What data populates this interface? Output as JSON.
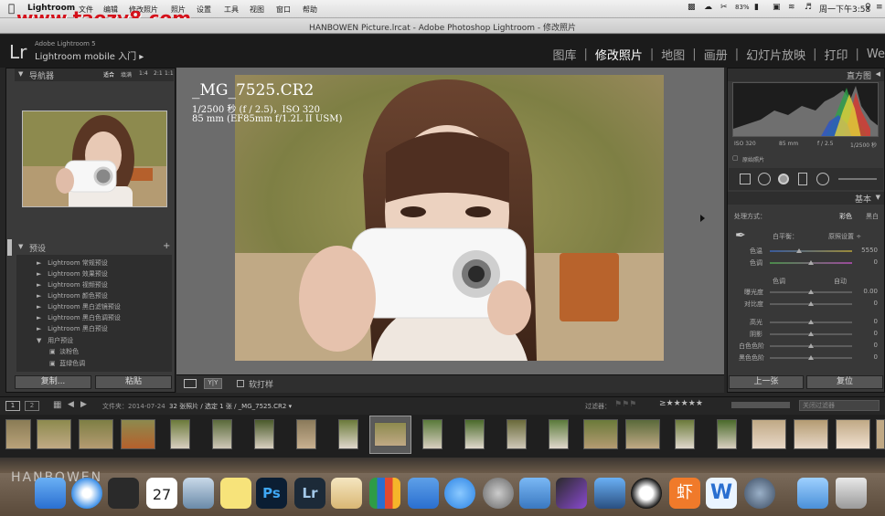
{
  "menubar": {
    "app": "Lightroom",
    "menus": [
      "文件",
      "编辑",
      "修改照片",
      "照片",
      "设置",
      "工具",
      "视图",
      "窗口",
      "帮助"
    ],
    "status_time": "周一下午3:58",
    "battery": "83%",
    "watermark": "www.taozy8.com"
  },
  "window": {
    "title": "HANBOWEN Picture.lrcat - Adobe Photoshop Lightroom - 修改照片"
  },
  "identity": {
    "logo": "Lr",
    "line1": "Adobe Lightroom 5",
    "line2": "Lightroom mobile 入门 ▸"
  },
  "modules": [
    {
      "label": "图库",
      "active": false
    },
    {
      "label": "修改照片",
      "active": true
    },
    {
      "label": "地图",
      "active": false
    },
    {
      "label": "画册",
      "active": false
    },
    {
      "label": "幻灯片放映",
      "active": false
    },
    {
      "label": "打印",
      "active": false
    },
    {
      "label": "We",
      "active": false
    }
  ],
  "navigator": {
    "title": "导航器",
    "zoom_options": [
      "适合",
      "填满",
      "1:4",
      "2:1",
      "1:1"
    ]
  },
  "presets": {
    "title": "预设",
    "items": [
      "Lightroom 常规预设",
      "Lightroom 效果预设",
      "Lightroom 视频预设",
      "Lightroom 颜色预设",
      "Lightroom 黑白滤镜预设",
      "Lightroom 黑白色调预设",
      "Lightroom 黑白预设",
      "用户预设",
      "淡粉色",
      "蓝绿色调"
    ]
  },
  "left_buttons": {
    "copy": "复制...",
    "paste": "粘贴"
  },
  "photo_info": {
    "filename": "_MG_7525.CR2",
    "exposure": "1/2500 秒 (f / 2.5)，ISO 320",
    "lens": "85 mm (EF85mm f/1.2L II USM)"
  },
  "toolbar": {
    "softproof": "软打样"
  },
  "histogram": {
    "title": "直方图",
    "iso": "ISO 320",
    "focal": "85 mm",
    "aperture": "f / 2.5",
    "shutter": "1/2500 秒",
    "original": "原始照片"
  },
  "basic": {
    "title": "基本",
    "treatment_label": "处理方式：",
    "color": "彩色",
    "bw": "黑白",
    "wb_label": "白平衡：",
    "wb_value": "原照设置 ÷",
    "temp_label": "色温",
    "temp_value": "5550",
    "tint_label": "色调",
    "tint_value": "0",
    "tone_label": "色调",
    "auto": "自动",
    "exposure_label": "曝光度",
    "exposure_value": "0.00",
    "contrast_label": "对比度",
    "contrast_value": "0",
    "highlights_label": "高光",
    "highlights_value": "0",
    "shadows_label": "阴影",
    "shadows_value": "0",
    "whites_label": "白色色阶",
    "whites_value": "0",
    "blacks_label": "黑色色阶",
    "blacks_value": "0"
  },
  "right_buttons": {
    "previous": "上一张",
    "reset": "复位"
  },
  "filmstrip_header": {
    "path": "文件夹：2014-07-24",
    "count": "32 张照片 / 选定 1 张 / _MG_7525.CR2 ▾",
    "filter_label": "过滤器：",
    "filter_value": "关闭过滤器"
  },
  "dock": {
    "items": [
      "finder",
      "safari",
      "calendar",
      "preview",
      "notes",
      "photoshop",
      "lightroom",
      "textedit",
      "numbers",
      "keynote",
      "appstore",
      "system-preferences",
      "xcode",
      "final-cut",
      "iphoto",
      "qq",
      "xiami",
      "word",
      "launchpad",
      "folder",
      "trash"
    ],
    "calendar_day": "27",
    "brand": "HANBOWEN"
  },
  "colors": {
    "accent": "#f0f0f0",
    "panel": "#3a3a3a",
    "viewer": "#6c6c6c"
  }
}
